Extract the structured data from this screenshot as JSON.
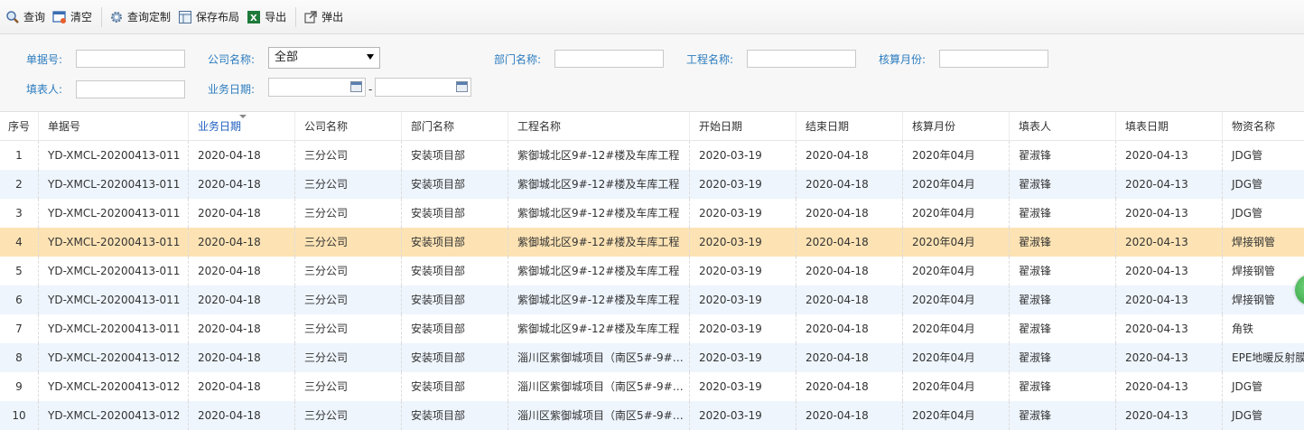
{
  "toolbar": {
    "query": "查询",
    "clear": "清空",
    "custom_query": "查询定制",
    "save_layout": "保存布局",
    "export": "导出",
    "popup": "弹出"
  },
  "filters": {
    "doc_no_label": "单据号:",
    "company_label": "公司名称:",
    "company_value": "全部",
    "dept_label": "部门名称:",
    "project_label": "工程名称:",
    "month_label": "核算月份:",
    "filler_label": "填表人:",
    "biz_date_label": "业务日期:",
    "date_sep": "-"
  },
  "columns": [
    "序号",
    "单据号",
    "业务日期",
    "公司名称",
    "部门名称",
    "工程名称",
    "开始日期",
    "结束日期",
    "核算月份",
    "填表人",
    "填表日期",
    "物资名称"
  ],
  "rows": [
    [
      "1",
      "YD-XMCL-20200413-011",
      "2020-04-18",
      "三分公司",
      "安装项目部",
      "紫御城北区9#-12#楼及车库工程",
      "2020-03-19",
      "2020-04-18",
      "2020年04月",
      "翟淑锋",
      "2020-04-13",
      "JDG管"
    ],
    [
      "2",
      "YD-XMCL-20200413-011",
      "2020-04-18",
      "三分公司",
      "安装项目部",
      "紫御城北区9#-12#楼及车库工程",
      "2020-03-19",
      "2020-04-18",
      "2020年04月",
      "翟淑锋",
      "2020-04-13",
      "JDG管"
    ],
    [
      "3",
      "YD-XMCL-20200413-011",
      "2020-04-18",
      "三分公司",
      "安装项目部",
      "紫御城北区9#-12#楼及车库工程",
      "2020-03-19",
      "2020-04-18",
      "2020年04月",
      "翟淑锋",
      "2020-04-13",
      "JDG管"
    ],
    [
      "4",
      "YD-XMCL-20200413-011",
      "2020-04-18",
      "三分公司",
      "安装项目部",
      "紫御城北区9#-12#楼及车库工程",
      "2020-03-19",
      "2020-04-18",
      "2020年04月",
      "翟淑锋",
      "2020-04-13",
      "焊接钢管"
    ],
    [
      "5",
      "YD-XMCL-20200413-011",
      "2020-04-18",
      "三分公司",
      "安装项目部",
      "紫御城北区9#-12#楼及车库工程",
      "2020-03-19",
      "2020-04-18",
      "2020年04月",
      "翟淑锋",
      "2020-04-13",
      "焊接钢管"
    ],
    [
      "6",
      "YD-XMCL-20200413-011",
      "2020-04-18",
      "三分公司",
      "安装项目部",
      "紫御城北区9#-12#楼及车库工程",
      "2020-03-19",
      "2020-04-18",
      "2020年04月",
      "翟淑锋",
      "2020-04-13",
      "焊接钢管"
    ],
    [
      "7",
      "YD-XMCL-20200413-011",
      "2020-04-18",
      "三分公司",
      "安装项目部",
      "紫御城北区9#-12#楼及车库工程",
      "2020-03-19",
      "2020-04-18",
      "2020年04月",
      "翟淑锋",
      "2020-04-13",
      "角铁"
    ],
    [
      "8",
      "YD-XMCL-20200413-012",
      "2020-04-18",
      "三分公司",
      "安装项目部",
      "淄川区紫御城项目（南区5#-9#…",
      "2020-03-19",
      "2020-04-18",
      "2020年04月",
      "翟淑锋",
      "2020-04-13",
      "EPE地暖反射膜"
    ],
    [
      "9",
      "YD-XMCL-20200413-012",
      "2020-04-18",
      "三分公司",
      "安装项目部",
      "淄川区紫御城项目（南区5#-9#…",
      "2020-03-19",
      "2020-04-18",
      "2020年04月",
      "翟淑锋",
      "2020-04-13",
      "JDG管"
    ],
    [
      "10",
      "YD-XMCL-20200413-012",
      "2020-04-18",
      "三分公司",
      "安装项目部",
      "淄川区紫御城项目（南区5#-9#…",
      "2020-03-19",
      "2020-04-18",
      "2020年04月",
      "翟淑锋",
      "2020-04-13",
      "JDG管"
    ]
  ],
  "selected_row": 4,
  "sorted_column": "业务日期",
  "colors": {
    "label_blue": "#2c7cbf",
    "alt_row": "#eef5fd",
    "selected_row": "#fde3b4"
  }
}
